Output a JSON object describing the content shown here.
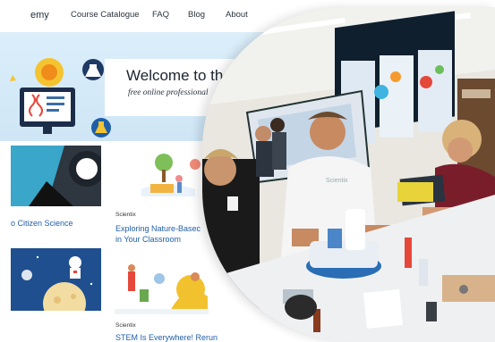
{
  "nav": {
    "logo_fragment": "emy",
    "items": [
      "Course Catalogue",
      "FAQ",
      "Blog",
      "About"
    ]
  },
  "hero": {
    "title": "Welcome to the",
    "subtitle": "free online professional"
  },
  "courses": [
    {
      "provider": "",
      "title": "o Citizen Science"
    },
    {
      "provider": "Scientix",
      "title_line1": "Exploring Nature-Basec",
      "title_line2": "in Your Classroom"
    },
    {
      "provider": "Scientix",
      "title": "STEM Is Everywhere! Rerun"
    }
  ],
  "photo": {
    "shirt_text": "Scientix",
    "corner_text": "Se"
  },
  "colors": {
    "brand_blue": "#1f5fa8",
    "hero_bg": "#d6ebf8",
    "dark_navy": "#1c2d4a"
  }
}
